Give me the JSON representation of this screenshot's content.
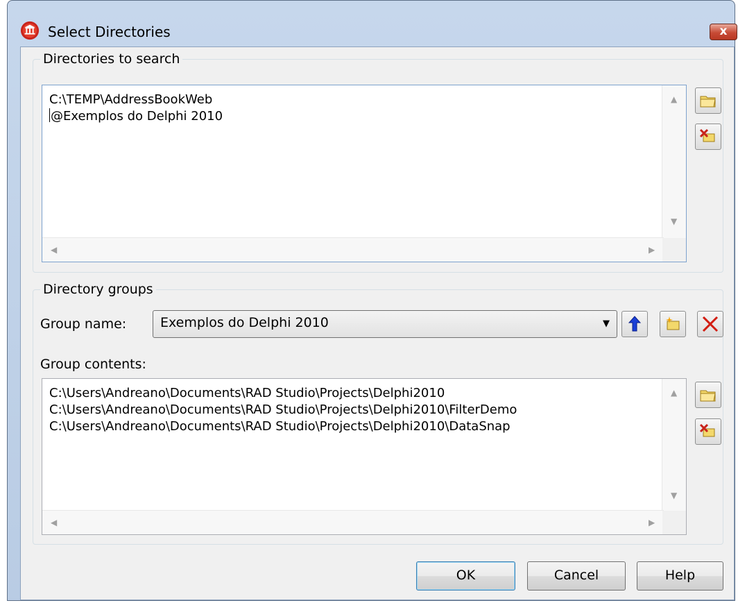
{
  "window": {
    "title": "Select Directories",
    "close_label": "x"
  },
  "search_group": {
    "legend": "Directories to search",
    "lines": [
      "C:\\TEMP\\AddressBookWeb",
      "@Exemplos do Delphi 2010"
    ]
  },
  "dir_groups": {
    "legend": "Directory groups",
    "group_name_label": "Group name:",
    "group_name_value": "Exemplos do Delphi 2010",
    "group_contents_label": "Group contents:",
    "lines": [
      "C:\\Users\\Andreano\\Documents\\RAD Studio\\Projects\\Delphi2010",
      "C:\\Users\\Andreano\\Documents\\RAD Studio\\Projects\\Delphi2010\\FilterDemo",
      "C:\\Users\\Andreano\\Documents\\RAD Studio\\Projects\\Delphi2010\\DataSnap"
    ]
  },
  "buttons": {
    "ok": "OK",
    "cancel": "Cancel",
    "help": "Help"
  }
}
